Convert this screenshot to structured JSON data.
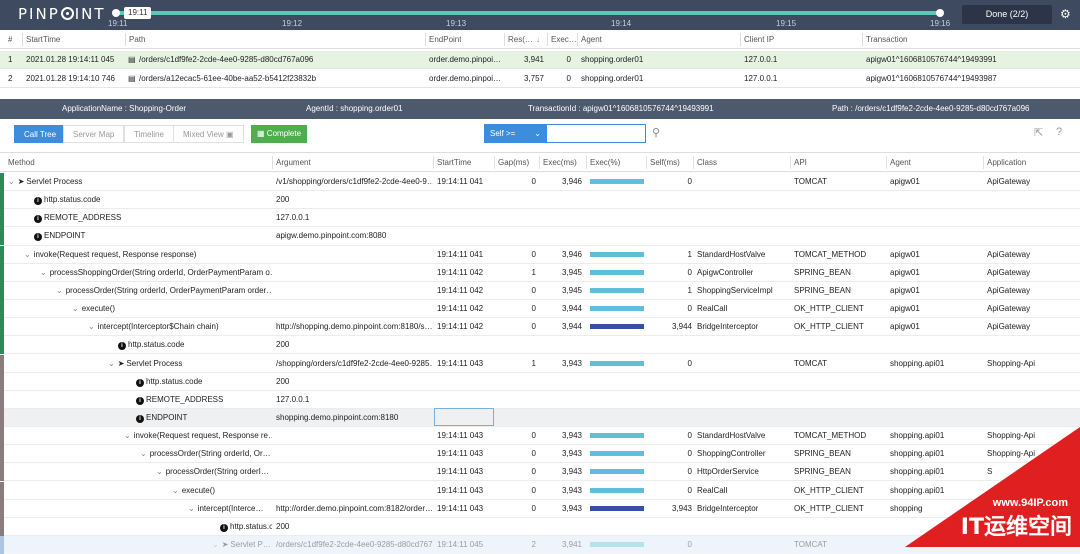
{
  "app": {
    "logo": "PINP",
    "logo_tail": "INT",
    "tooltip_time": "19:11",
    "done_label": "Done (2/2)"
  },
  "timeline_ticks": [
    "19:11",
    "19:12",
    "19:13",
    "19:14",
    "19:15",
    "19:16"
  ],
  "list_headers": [
    "#",
    "StartTime",
    "Path",
    "EndPoint",
    "Res(…",
    "Exec…",
    "Agent",
    "Client IP",
    "Transaction"
  ],
  "list_rows": [
    {
      "n": "1",
      "start": "2021.01.28 19:14:11 045",
      "path": "/orders/c1df9fe2-2cde-4ee0-9285-d80cd767a096",
      "endpoint": "order.demo.pinpoi…",
      "res": "3,941",
      "exec": "0",
      "agent": "shopping.order01",
      "ip": "127.0.0.1",
      "tx": "apigw01^1606810576744^19493991"
    },
    {
      "n": "2",
      "start": "2021.01.28 19:14:10 746",
      "path": "/orders/a12ecac5-61ee-40be-aa52-b5412f23832b",
      "endpoint": "order.demo.pinpoi…",
      "res": "3,757",
      "exec": "0",
      "agent": "shopping.order01",
      "ip": "127.0.0.1",
      "tx": "apigw01^1606810576744^19493987"
    }
  ],
  "info": {
    "app": "ApplicationName : Shopping-Order",
    "agent": "AgentId : shopping.order01",
    "tx": "TransactionId : apigw01^1606810576744^19493991",
    "path": "Path : /orders/c1df9fe2-2cde-4ee0-9285-d80cd767a096"
  },
  "tabs": [
    "Call Tree",
    "Server Map",
    "Timeline",
    "Mixed View"
  ],
  "complete_label": "Complete",
  "self_select": "Self >=",
  "tree_headers": [
    "Method",
    "Argument",
    "StartTime",
    "Gap(ms)",
    "Exec(ms)",
    "Exec(%)",
    "Self(ms)",
    "Class",
    "API",
    "Agent",
    "Application"
  ],
  "tree_rows": [
    {
      "ind": 8,
      "ico": "caret-send",
      "m": "Servlet Process",
      "arg": "/v1/shopping/orders/c1df9fe2-2cde-4ee0-9…",
      "st": "19:14:11 041",
      "gap": "0",
      "ex": "3,946",
      "pct": 1.0,
      "dark": false,
      "self": "0",
      "cls": "",
      "api": "TOMCAT",
      "ag": "apigw01",
      "appn": "ApiGateway",
      "stripe": "g"
    },
    {
      "ind": 34,
      "ico": "info",
      "m": "http.status.code",
      "arg": "200",
      "st": "",
      "gap": "",
      "ex": "",
      "pct": null,
      "self": "",
      "cls": "",
      "api": "",
      "ag": "",
      "appn": "",
      "stripe": "g"
    },
    {
      "ind": 34,
      "ico": "info",
      "m": "REMOTE_ADDRESS",
      "arg": "127.0.0.1",
      "st": "",
      "gap": "",
      "ex": "",
      "pct": null,
      "self": "",
      "cls": "",
      "api": "",
      "ag": "",
      "appn": "",
      "stripe": "g"
    },
    {
      "ind": 34,
      "ico": "info",
      "m": "ENDPOINT",
      "arg": "apigw.demo.pinpoint.com:8080",
      "st": "",
      "gap": "",
      "ex": "",
      "pct": null,
      "self": "",
      "cls": "",
      "api": "",
      "ag": "",
      "appn": "",
      "stripe": "g"
    },
    {
      "ind": 24,
      "ico": "caret",
      "m": "invoke(Request request, Response response)",
      "arg": "",
      "st": "19:14:11 041",
      "gap": "0",
      "ex": "3,946",
      "pct": 1.0,
      "dark": false,
      "self": "1",
      "cls": "StandardHostValve",
      "api": "TOMCAT_METHOD",
      "ag": "apigw01",
      "appn": "ApiGateway",
      "stripe": "g"
    },
    {
      "ind": 40,
      "ico": "caret",
      "m": "processShoppingOrder(String orderId, OrderPaymentParam o…",
      "arg": "",
      "st": "19:14:11 042",
      "gap": "1",
      "ex": "3,945",
      "pct": 1.0,
      "dark": false,
      "self": "0",
      "cls": "ApigwController",
      "api": "SPRING_BEAN",
      "ag": "apigw01",
      "appn": "ApiGateway",
      "stripe": "g"
    },
    {
      "ind": 56,
      "ico": "caret",
      "m": "processOrder(String orderId, OrderPaymentParam order…",
      "arg": "",
      "st": "19:14:11 042",
      "gap": "0",
      "ex": "3,945",
      "pct": 1.0,
      "dark": false,
      "self": "1",
      "cls": "ShoppingServiceImpl",
      "api": "SPRING_BEAN",
      "ag": "apigw01",
      "appn": "ApiGateway",
      "stripe": "g"
    },
    {
      "ind": 72,
      "ico": "caret",
      "m": "execute()",
      "arg": "",
      "st": "19:14:11 042",
      "gap": "0",
      "ex": "3,944",
      "pct": 1.0,
      "dark": false,
      "self": "0",
      "cls": "RealCall",
      "api": "OK_HTTP_CLIENT",
      "ag": "apigw01",
      "appn": "ApiGateway",
      "stripe": "g"
    },
    {
      "ind": 88,
      "ico": "caret",
      "m": "intercept(Interceptor$Chain chain)",
      "arg": "http://shopping.demo.pinpoint.com:8180/s…",
      "st": "19:14:11 042",
      "gap": "0",
      "ex": "3,944",
      "pct": 1.0,
      "dark": true,
      "self": "3,944",
      "cls": "BridgeInterceptor",
      "api": "OK_HTTP_CLIENT",
      "ag": "apigw01",
      "appn": "ApiGateway",
      "stripe": "g"
    },
    {
      "ind": 118,
      "ico": "info",
      "m": "http.status.code",
      "arg": "200",
      "st": "",
      "gap": "",
      "ex": "",
      "pct": null,
      "self": "",
      "cls": "",
      "api": "",
      "ag": "",
      "appn": "",
      "stripe": "g"
    },
    {
      "ind": 108,
      "ico": "caret-send",
      "m": "Servlet Process",
      "arg": "/shopping/orders/c1df9fe2-2cde-4ee0-9285…",
      "st": "19:14:11 043",
      "gap": "1",
      "ex": "3,943",
      "pct": 1.0,
      "dark": false,
      "self": "0",
      "cls": "",
      "api": "TOMCAT",
      "ag": "shopping.api01",
      "appn": "Shopping-Api",
      "stripe": "p"
    },
    {
      "ind": 136,
      "ico": "info",
      "m": "http.status.code",
      "arg": "200",
      "st": "",
      "gap": "",
      "ex": "",
      "pct": null,
      "self": "",
      "cls": "",
      "api": "",
      "ag": "",
      "appn": "",
      "stripe": "p"
    },
    {
      "ind": 136,
      "ico": "info",
      "m": "REMOTE_ADDRESS",
      "arg": "127.0.0.1",
      "st": "",
      "gap": "",
      "ex": "",
      "pct": null,
      "self": "",
      "cls": "",
      "api": "",
      "ag": "",
      "appn": "",
      "stripe": "p"
    },
    {
      "ind": 136,
      "ico": "info",
      "m": "ENDPOINT",
      "arg": "shopping.demo.pinpoint.com:8180",
      "st": "",
      "gap": "",
      "ex": "",
      "pct": null,
      "self": "",
      "cls": "",
      "api": "",
      "ag": "",
      "appn": "",
      "stripe": "p",
      "hl": true
    },
    {
      "ind": 124,
      "ico": "caret",
      "m": "invoke(Request request, Response re…",
      "arg": "",
      "st": "19:14:11 043",
      "gap": "0",
      "ex": "3,943",
      "pct": 1.0,
      "dark": false,
      "self": "0",
      "cls": "StandardHostValve",
      "api": "TOMCAT_METHOD",
      "ag": "shopping.api01",
      "appn": "Shopping-Api",
      "stripe": "p"
    },
    {
      "ind": 140,
      "ico": "caret",
      "m": "processOrder(String orderId, Or…",
      "arg": "",
      "st": "19:14:11 043",
      "gap": "0",
      "ex": "3,943",
      "pct": 1.0,
      "dark": false,
      "self": "0",
      "cls": "ShoppingController",
      "api": "SPRING_BEAN",
      "ag": "shopping.api01",
      "appn": "Shopping-Api",
      "stripe": "p"
    },
    {
      "ind": 156,
      "ico": "caret",
      "m": "processOrder(String orderI…",
      "arg": "",
      "st": "19:14:11 043",
      "gap": "0",
      "ex": "3,943",
      "pct": 1.0,
      "dark": false,
      "self": "0",
      "cls": "HttpOrderService",
      "api": "SPRING_BEAN",
      "ag": "shopping.api01",
      "appn": "S",
      "stripe": "p"
    },
    {
      "ind": 172,
      "ico": "caret",
      "m": "execute()",
      "arg": "",
      "st": "19:14:11 043",
      "gap": "0",
      "ex": "3,943",
      "pct": 1.0,
      "dark": false,
      "self": "0",
      "cls": "RealCall",
      "api": "OK_HTTP_CLIENT",
      "ag": "shopping.api01",
      "appn": "",
      "stripe": "p"
    },
    {
      "ind": 188,
      "ico": "caret",
      "m": "intercept(Interce…",
      "arg": "http://order.demo.pinpoint.com:8182/order…",
      "st": "19:14:11 043",
      "gap": "0",
      "ex": "3,943",
      "pct": 1.0,
      "dark": true,
      "self": "3,943",
      "cls": "BridgeInterceptor",
      "api": "OK_HTTP_CLIENT",
      "ag": "shopping",
      "appn": "",
      "stripe": "p"
    },
    {
      "ind": 220,
      "ico": "info",
      "m": "http.status.c",
      "arg": "200",
      "st": "",
      "gap": "",
      "ex": "",
      "pct": null,
      "self": "",
      "cls": "",
      "api": "",
      "ag": "",
      "appn": "",
      "stripe": "p"
    },
    {
      "ind": 212,
      "ico": "caret-send",
      "m": "Servlet P…",
      "arg": "/orders/c1df9fe2-2cde-4ee0-9285-d80cd767…",
      "st": "19:14:11 045",
      "gap": "2",
      "ex": "3,941",
      "pct": 1.0,
      "dark": false,
      "self": "0",
      "cls": "",
      "api": "TOMCAT",
      "ag": "",
      "appn": "",
      "stripe": "b",
      "last": true
    }
  ],
  "watermark": {
    "url": "www.94IP.com",
    "name": "IT运维空间"
  }
}
